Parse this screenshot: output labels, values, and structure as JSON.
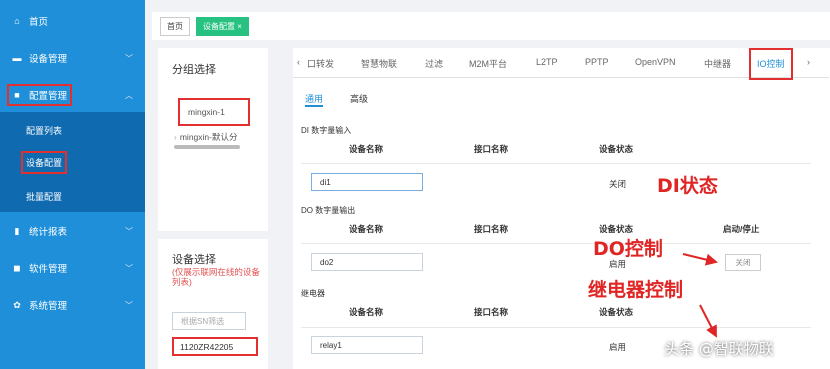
{
  "sidebar": {
    "items": [
      {
        "label": "首页",
        "icon": "home-icon",
        "glyph": "⌂"
      },
      {
        "label": "设备管理",
        "icon": "device-icon",
        "glyph": "▬"
      },
      {
        "label": "配置管理",
        "icon": "folder-icon",
        "glyph": "■"
      },
      {
        "label": "统计报表",
        "icon": "chart-icon",
        "glyph": "▮"
      },
      {
        "label": "软件管理",
        "icon": "package-icon",
        "glyph": "◼"
      },
      {
        "label": "系统管理",
        "icon": "gear-icon",
        "glyph": "✿"
      }
    ],
    "sub_items": [
      "配置列表",
      "设备配置",
      "批量配置"
    ]
  },
  "breadcrumb": {
    "home": "首页",
    "active": "设备配置 ×"
  },
  "group_panel": {
    "title": "分组选择",
    "tree": [
      "mingxin-1",
      "mingxin-默认分"
    ]
  },
  "device_panel": {
    "title": "设备选择",
    "hint": "(仅展示联网在线的设备列表)",
    "search_placeholder": "根据SN筛选",
    "selected_sn": "1120ZR42205"
  },
  "tabs": {
    "left_arrow": "‹",
    "right_arrow": "›",
    "items": [
      "口转发",
      "智慧物联",
      "过滤",
      "M2M平台",
      "L2TP",
      "PPTP",
      "OpenVPN",
      "中继器",
      "IO控制"
    ]
  },
  "subtabs": [
    "通用",
    "高级"
  ],
  "di": {
    "section": "DI 数字量输入",
    "headers": [
      "设备名称",
      "接口名称",
      "设备状态"
    ],
    "name": "di1",
    "status": "关闭"
  },
  "do": {
    "section": "DO 数字量输出",
    "headers": [
      "设备名称",
      "接口名称",
      "设备状态",
      "启动/停止"
    ],
    "name": "do2",
    "status": "启用",
    "button": "关闭"
  },
  "relay": {
    "section": "继电器",
    "headers": [
      "设备名称",
      "接口名称",
      "设备状态"
    ],
    "name": "relay1",
    "status": "启用"
  },
  "annotations": {
    "di_state": "DI状态",
    "do_control": "DO控制",
    "relay_control": "继电器控制"
  },
  "watermark": "头条 @智联物联",
  "colors": {
    "sidebar": "#1f8fd9",
    "sidebar_sub": "#0f6ab0",
    "accent": "#1f8fd9",
    "crumb_active": "#27c281",
    "annotation": "#e02525"
  }
}
